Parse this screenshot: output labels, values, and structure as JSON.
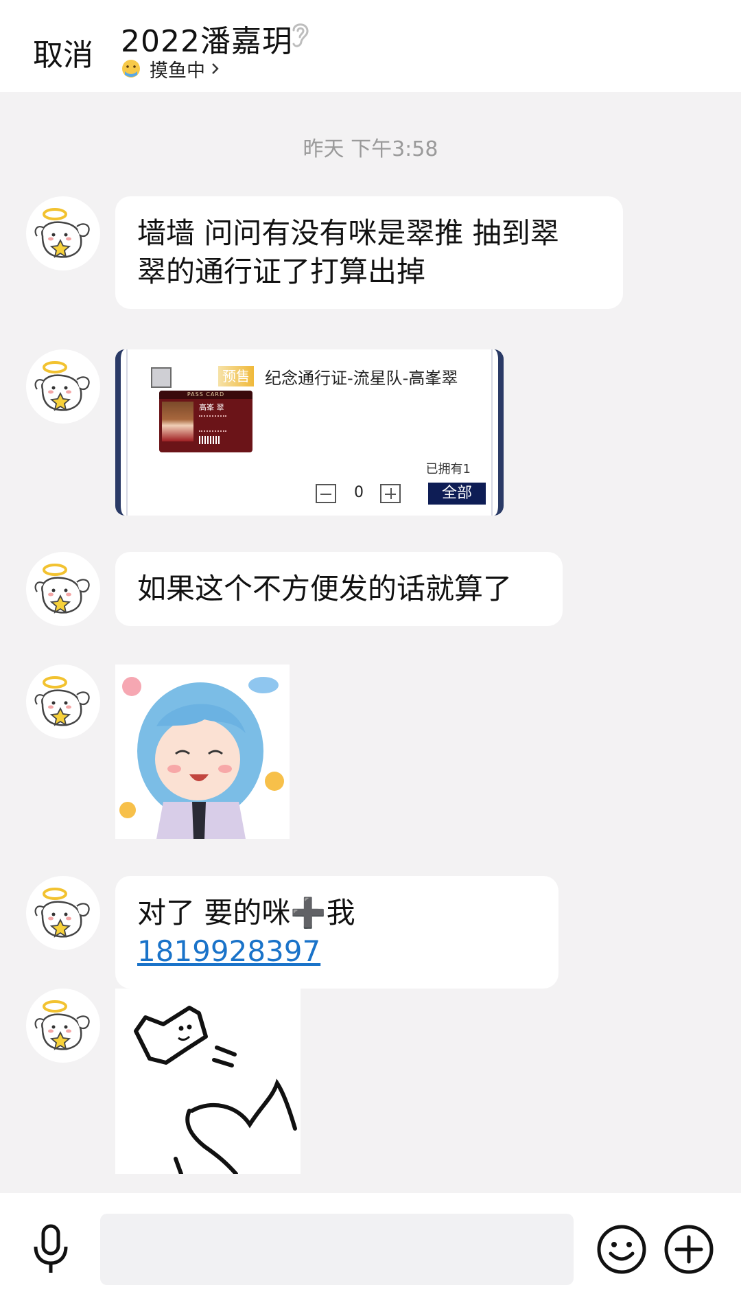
{
  "header": {
    "cancel_label": "取消",
    "title": "2022潘嘉玥",
    "status_text": "摸鱼中"
  },
  "chat": {
    "timestamp": "昨天 下午3:58",
    "messages": [
      {
        "type": "text",
        "text": "墙墙 问问有没有咪是翠推 抽到翠",
        "text2": "翠的通行证了打算出掉"
      },
      {
        "type": "card",
        "tag": "预售",
        "title": "纪念通行证-流星队-高峯翠",
        "pass_label": "PASS CARD",
        "pass_name": "高峯 翠",
        "owned": "已拥有1",
        "quantity": "0",
        "all_button": "全部"
      },
      {
        "type": "text",
        "text": "如果这个不方便发的话就算了"
      },
      {
        "type": "sticker"
      },
      {
        "type": "text",
        "prefix": "对了 要的咪",
        "plus": "➕",
        "mid": "我",
        "link": "1819928397"
      },
      {
        "type": "sticker"
      }
    ]
  },
  "colors": {
    "link": "#1a73c9",
    "card_button": "#0e1d55",
    "background": "#f3f2f3"
  }
}
